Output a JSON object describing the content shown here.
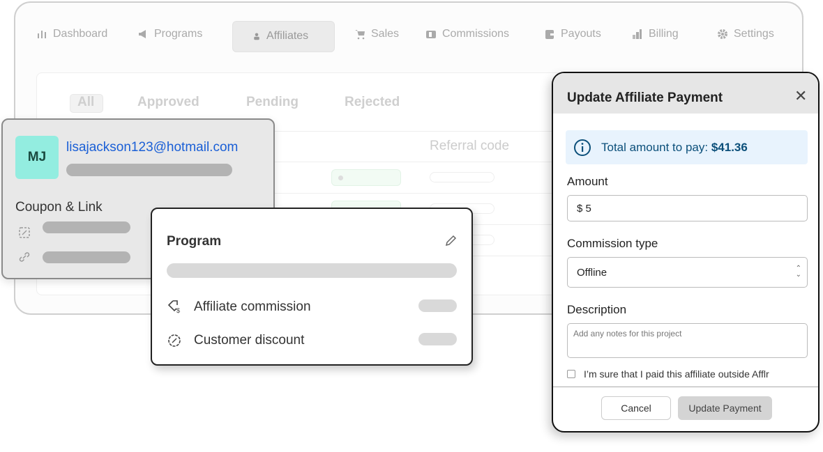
{
  "nav": [
    {
      "label": "Dashboard",
      "icon": "bar-chart-icon"
    },
    {
      "label": "Programs",
      "icon": "megaphone-icon"
    },
    {
      "label": "Affiliates",
      "icon": "user-icon",
      "active": true
    },
    {
      "label": "Sales",
      "icon": "cart-icon"
    },
    {
      "label": "Commissions",
      "icon": "money-icon"
    },
    {
      "label": "Payouts",
      "icon": "wallet-icon"
    },
    {
      "label": "Billing",
      "icon": "billing-icon"
    },
    {
      "label": "Settings",
      "icon": "gear-icon"
    }
  ],
  "filters": [
    "All",
    "Approved",
    "Pending",
    "Rejected"
  ],
  "table": {
    "column": "Referral code"
  },
  "affiliate": {
    "initials": "MJ",
    "email": "lisajackson123@hotmail.com",
    "section": "Coupon & Link",
    "avatar_color": "#93ede0"
  },
  "program": {
    "title": "Program",
    "rows": [
      "Affiliate commission",
      "Customer discount"
    ]
  },
  "modal": {
    "title": "Update Affiliate Payment",
    "info_prefix": "Total amount to pay: ",
    "info_amount": "$41.36",
    "amount_label": "Amount",
    "amount_value": "$ 5",
    "type_label": "Commission type",
    "type_value": "Offline",
    "desc_label": "Description",
    "desc_placeholder": "Add any notes for this project",
    "confirm_text": "I’m sure that I paid this affiliate outside Afflr",
    "cancel": "Cancel",
    "submit": "Update Payment"
  }
}
